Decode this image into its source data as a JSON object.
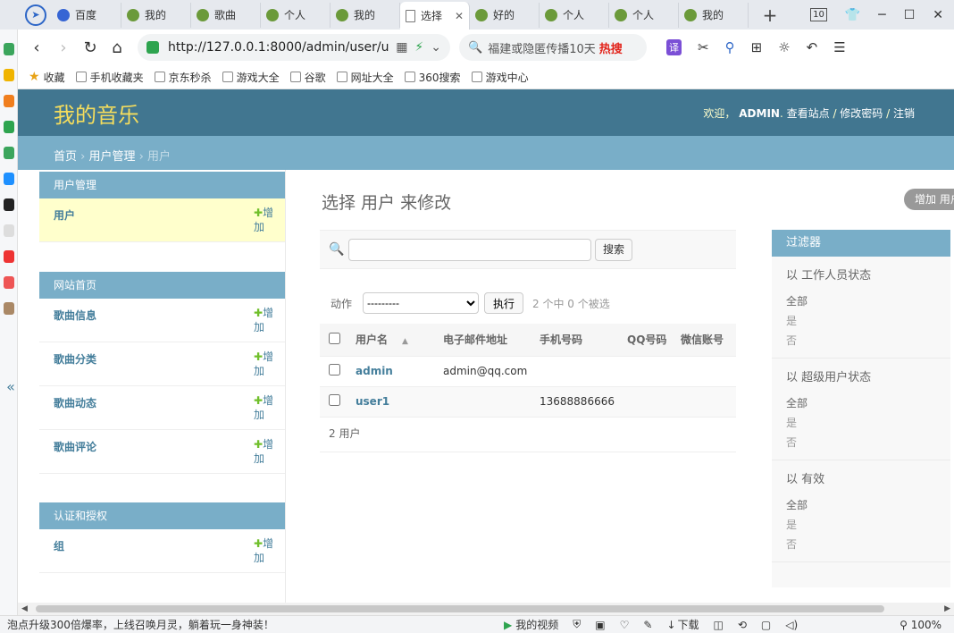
{
  "browser": {
    "tabs": [
      {
        "label": "百度",
        "icon": "paw-icon"
      },
      {
        "label": "我的",
        "icon": "app-icon"
      },
      {
        "label": "歌曲",
        "icon": "app-icon"
      },
      {
        "label": "个人",
        "icon": "app-icon"
      },
      {
        "label": "我的",
        "icon": "app-icon"
      },
      {
        "label": "选择",
        "icon": "doc-icon"
      },
      {
        "label": "好的",
        "icon": "app-icon"
      },
      {
        "label": "个人",
        "icon": "app-icon"
      },
      {
        "label": "个人",
        "icon": "app-icon"
      },
      {
        "label": "我的",
        "icon": "app-icon"
      }
    ],
    "tab_count": "10",
    "url": "http://127.0.0.1:8000/admin/user/u",
    "search_text": "福建或隐匿传播10天",
    "search_hot": "热搜",
    "translate_label": "译",
    "bookmarks": [
      "收藏",
      "手机收藏夹",
      "京东秒杀",
      "游戏大全",
      "谷歌",
      "网址大全",
      "360搜索",
      "游戏中心"
    ]
  },
  "admin": {
    "site_title": "我的音乐",
    "welcome": "欢迎，",
    "username": "ADMIN",
    "links": [
      "查看站点",
      "修改密码",
      "注销"
    ],
    "breadcrumb": {
      "home": "首页",
      "app": "用户管理",
      "current": "用户"
    }
  },
  "sidebar": {
    "modules": [
      {
        "caption": "用户管理",
        "rows": [
          {
            "name": "用户",
            "add": "增加",
            "selected": true
          }
        ]
      },
      {
        "caption": "网站首页",
        "rows": [
          {
            "name": "歌曲信息",
            "add": "增加"
          },
          {
            "name": "歌曲分类",
            "add": "增加"
          },
          {
            "name": "歌曲动态",
            "add": "增加"
          },
          {
            "name": "歌曲评论",
            "add": "增加"
          }
        ]
      },
      {
        "caption": "认证和授权",
        "rows": [
          {
            "name": "组",
            "add": "增加"
          }
        ]
      }
    ]
  },
  "main": {
    "title": "选择 用户 来修改",
    "add_button": "增加 用户",
    "search_button": "搜索",
    "actions_label": "动作",
    "action_default": "---------",
    "go_button": "执行",
    "selection_count": "2 个中 0 个被选",
    "columns": [
      "用户名",
      "电子邮件地址",
      "手机号码",
      "QQ号码",
      "微信账号"
    ],
    "rows": [
      {
        "username": "admin",
        "email": "admin@qq.com",
        "phone": "",
        "qq": "",
        "wechat": ""
      },
      {
        "username": "user1",
        "email": "",
        "phone": "13688886666",
        "qq": "",
        "wechat": ""
      }
    ],
    "result_count": "2 用户"
  },
  "filter": {
    "caption": "过滤器",
    "groups": [
      {
        "title": "以 工作人员状态",
        "options": [
          "全部",
          "是",
          "否"
        ]
      },
      {
        "title": "以 超级用户状态",
        "options": [
          "全部",
          "是",
          "否"
        ]
      },
      {
        "title": "以 有效",
        "options": [
          "全部",
          "是",
          "否"
        ]
      }
    ]
  },
  "statusbar": {
    "news": "泡点升级300倍爆率，上线召唤月灵，躺着玩一身神装！",
    "video": "我的视频",
    "download": "下载",
    "zoom": "100%"
  }
}
